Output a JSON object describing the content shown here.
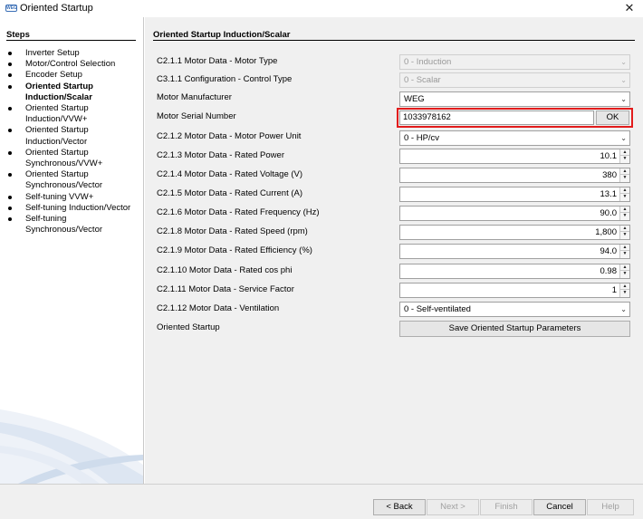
{
  "window": {
    "title": "Oriented Startup",
    "logo_text": "WEG",
    "close_glyph": "✕"
  },
  "steps": {
    "title": "Steps",
    "items": [
      {
        "label": "Inverter Setup",
        "active": false
      },
      {
        "label": "Motor/Control Selection",
        "active": false
      },
      {
        "label": "Encoder Setup",
        "active": false
      },
      {
        "label": "Oriented Startup Induction/Scalar",
        "line1": "Oriented Startup",
        "line2": "Induction/Scalar",
        "active": true
      },
      {
        "label": "Oriented Startup Induction/VVW+",
        "line1": "Oriented Startup",
        "line2": "Induction/VVW+",
        "active": false
      },
      {
        "label": "Oriented Startup Induction/Vector",
        "line1": "Oriented Startup",
        "line2": "Induction/Vector",
        "active": false
      },
      {
        "label": "Oriented Startup Synchronous/VVW+",
        "line1": "Oriented Startup",
        "line2": "Synchronous/VVW+",
        "active": false
      },
      {
        "label": "Oriented Startup Synchronous/Vector",
        "line1": "Oriented Startup",
        "line2": "Synchronous/Vector",
        "active": false
      },
      {
        "label": "Self-tuning VVW+",
        "active": false
      },
      {
        "label": "Self-tuning Induction/Vector",
        "active": false
      },
      {
        "label": "Self-tuning Synchronous/Vector",
        "line1": "Self-tuning",
        "line2": "Synchronous/Vector",
        "active": false
      }
    ]
  },
  "form": {
    "section_title": "Oriented Startup Induction/Scalar",
    "motor_type": {
      "label": "C2.1.1 Motor Data - Motor Type",
      "value": "0 - Induction"
    },
    "control_type": {
      "label": "C3.1.1 Configuration - Control Type",
      "value": "0 - Scalar"
    },
    "manufacturer": {
      "label": "Motor Manufacturer",
      "value": "WEG"
    },
    "serial": {
      "label": "Motor Serial Number",
      "value": "1033978162",
      "ok_label": "OK"
    },
    "power_unit": {
      "label": "C2.1.2 Motor Data - Motor Power Unit",
      "value": "0 - HP/cv"
    },
    "rated_power": {
      "label": "C2.1.3 Motor Data - Rated Power",
      "value": "10.1"
    },
    "rated_voltage": {
      "label": "C2.1.4 Motor Data - Rated Voltage (V)",
      "value": "380"
    },
    "rated_current": {
      "label": "C2.1.5 Motor Data - Rated Current (A)",
      "value": "13.1"
    },
    "rated_frequency": {
      "label": "C2.1.6 Motor Data - Rated Frequency (Hz)",
      "value": "90.0"
    },
    "rated_speed": {
      "label": "C2.1.8 Motor Data - Rated Speed (rpm)",
      "value": "1,800"
    },
    "rated_efficiency": {
      "label": "C2.1.9 Motor Data - Rated Efficiency (%)",
      "value": "94.0"
    },
    "cos_phi": {
      "label": "C2.1.10 Motor Data - Rated cos phi",
      "value": "0.98"
    },
    "service_factor": {
      "label": "C2.1.11 Motor Data - Service Factor",
      "value": "1"
    },
    "ventilation": {
      "label": "C2.1.12 Motor Data - Ventilation",
      "value": "0 - Self-ventilated"
    },
    "oriented_startup": {
      "label": "Oriented Startup",
      "button_label": "Save Oriented Startup Parameters"
    }
  },
  "nav": {
    "back": "< Back",
    "next": "Next >",
    "finish": "Finish",
    "cancel": "Cancel",
    "help": "Help"
  },
  "colors": {
    "highlight": "#e21c1c",
    "panel_bg": "#f0f0f0"
  }
}
